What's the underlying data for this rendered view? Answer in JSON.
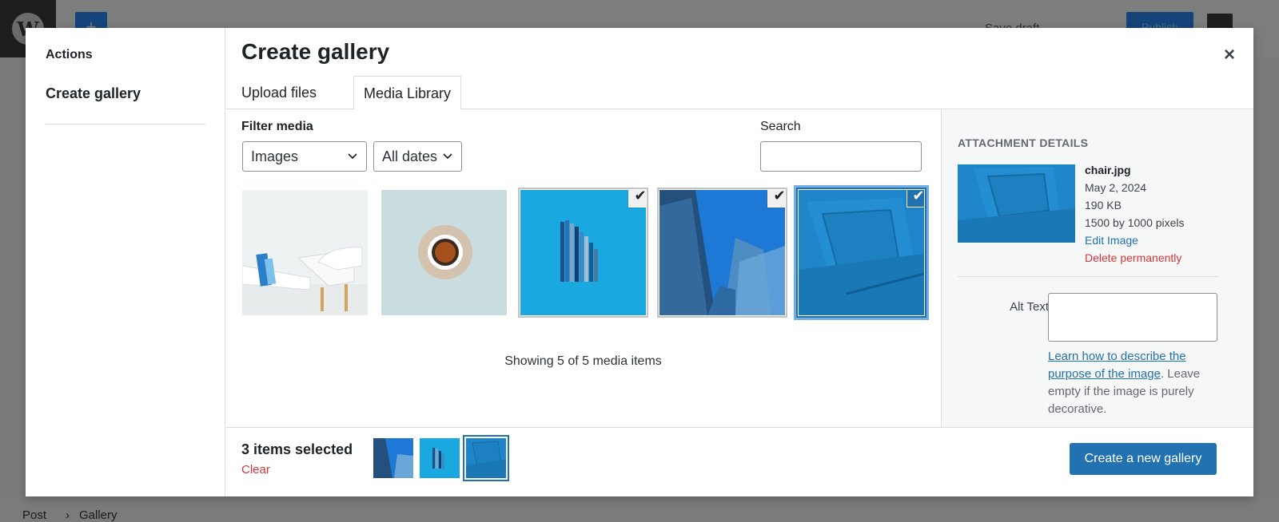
{
  "editor": {
    "save_draft": "Save draft",
    "publish": "Publish",
    "breadcrumb": [
      "Post",
      "Gallery"
    ],
    "logo_glyph": "W"
  },
  "modal": {
    "menu_heading": "Actions",
    "menu_item": "Create gallery",
    "title": "Create gallery",
    "close_glyph": "×",
    "tabs": [
      "Upload files",
      "Media Library"
    ]
  },
  "filters": {
    "label": "Filter media",
    "type_value": "Images",
    "date_value": "All dates",
    "search_label": "Search",
    "search_value": ""
  },
  "media": {
    "items": [
      {
        "name": "white-table-chairs",
        "selected": false
      },
      {
        "name": "coffee-cup",
        "selected": false
      },
      {
        "name": "blue-pencils",
        "selected": true
      },
      {
        "name": "skyscrapers",
        "selected": true
      },
      {
        "name": "chair",
        "selected": true,
        "active": true
      }
    ],
    "check_glyph": "✔",
    "showing": "Showing 5 of 5 media items"
  },
  "details": {
    "heading": "ATTACHMENT DETAILS",
    "filename": "chair.jpg",
    "date": "May 2, 2024",
    "size": "190 KB",
    "dimensions": "1500 by 1000 pixels",
    "edit": "Edit Image",
    "delete": "Delete permanently",
    "alt_label": "Alt Text",
    "alt_value": "",
    "help_link": "Learn how to describe the purpose of the image",
    "help_text": ". Leave empty if the image is purely decorative."
  },
  "toolbar": {
    "count": "3 items selected",
    "clear": "Clear",
    "create": "Create a new gallery"
  },
  "colors": {
    "accent": "#2271b1",
    "danger": "#d63638",
    "image_blue": "#1aa3dc"
  }
}
